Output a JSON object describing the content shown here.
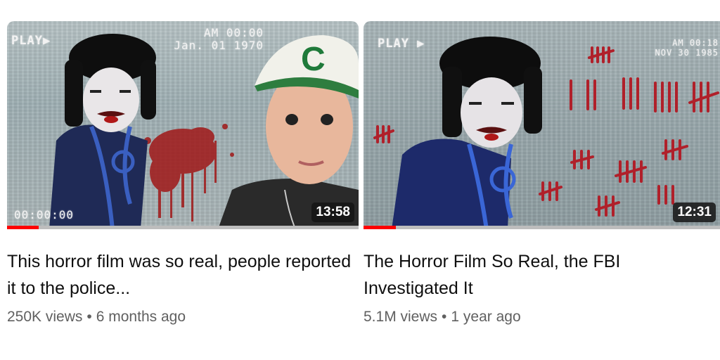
{
  "videos": [
    {
      "overlay": {
        "play": "PLAY▶",
        "time": "AM 00:00",
        "date": "Jan. 01 1970",
        "counter": "00:00:00"
      },
      "duration": "13:58",
      "progress": 0.09,
      "title": "This horror film was so real, people reported it to the police...",
      "views": "250K views",
      "separator": "•",
      "age": "6 months ago"
    },
    {
      "overlay": {
        "play": "PLAY ▶",
        "time": "AM 00:18",
        "date": "NOV 30 1985"
      },
      "duration": "12:31",
      "progress": 0.09,
      "title": "The Horror Film So Real, the FBI Investigated It",
      "views": "5.1M views",
      "separator": "•",
      "age": "1 year ago"
    }
  ],
  "colors": {
    "progress_fill": "#ff0000",
    "blood": "#a01818",
    "tally": "#b0202a",
    "cap_logo": "#1f7a3a"
  }
}
